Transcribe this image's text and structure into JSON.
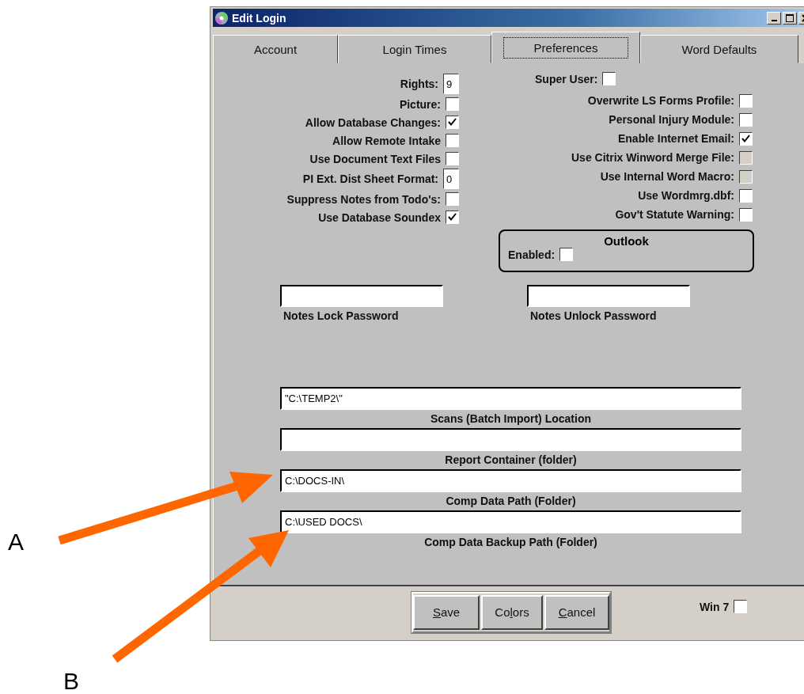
{
  "window": {
    "title": "Edit Login"
  },
  "tabs": [
    {
      "label": "Account",
      "selected": false
    },
    {
      "label": "Login Times",
      "selected": false
    },
    {
      "label": "Preferences",
      "selected": true
    },
    {
      "label": "Word Defaults",
      "selected": false
    }
  ],
  "left_options": [
    {
      "kind": "number",
      "label": "Rights:",
      "value": "9"
    },
    {
      "kind": "checkbox",
      "label": "Picture:",
      "checked": false
    },
    {
      "kind": "checkbox",
      "label": "Allow Database Changes:",
      "checked": true
    },
    {
      "kind": "checkbox",
      "label": "Allow Remote Intake",
      "checked": false
    },
    {
      "kind": "checkbox",
      "label": "Use Document Text Files",
      "checked": false
    },
    {
      "kind": "number",
      "label": "PI Ext. Dist Sheet Format:",
      "value": "0"
    },
    {
      "kind": "checkbox",
      "label": "Suppress Notes from Todo's:",
      "checked": false
    },
    {
      "kind": "checkbox",
      "label": "Use Database Soundex",
      "checked": true
    }
  ],
  "super_user": {
    "label": "Super User:",
    "checked": false
  },
  "right_options": [
    {
      "label": "Overwrite LS Forms Profile:",
      "checked": false,
      "disabled": false
    },
    {
      "label": "Personal Injury Module:",
      "checked": false,
      "disabled": false
    },
    {
      "label": "Enable Internet Email:",
      "checked": true,
      "disabled": false
    },
    {
      "label": "Use Citrix Winword Merge File:",
      "checked": false,
      "disabled": true
    },
    {
      "label": "Use Internal Word Macro:",
      "checked": false,
      "disabled": true
    },
    {
      "label": "Use Wordmrg.dbf:",
      "checked": false,
      "disabled": false
    },
    {
      "label": "Gov't Statute Warning:",
      "checked": false,
      "disabled": false
    }
  ],
  "outlook": {
    "title": "Outlook",
    "label": "Enabled:",
    "checked": false
  },
  "password_fields": [
    {
      "label": "Notes Lock Password"
    },
    {
      "label": "Notes Unlock Password"
    }
  ],
  "path_fields": [
    {
      "label": "Scans (Batch Import) Location",
      "value": "\"C:\\TEMP2\\\""
    },
    {
      "label": "Report Container (folder)"
    },
    {
      "label": "Comp Data Path (Folder)",
      "value": "C:\\DOCS-IN\\"
    },
    {
      "label": "Comp Data Backup Path (Folder)",
      "value": "C:\\USED DOCS\\"
    }
  ],
  "buttons": [
    {
      "key": "S",
      "post": "ave"
    },
    {
      "pre": "Co",
      "key": "l",
      "post": "ors"
    },
    {
      "key": "C",
      "post": "ancel"
    }
  ],
  "win7": {
    "label": "Win 7",
    "checked": false
  },
  "annotations": [
    {
      "label": "A"
    },
    {
      "label": "B"
    }
  ]
}
